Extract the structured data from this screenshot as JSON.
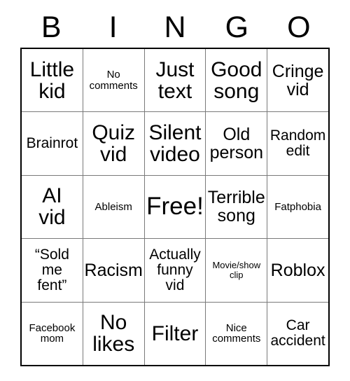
{
  "card": {
    "headers": [
      "B",
      "I",
      "N",
      "G",
      "O"
    ],
    "free_space_label": "Free!",
    "rows": [
      [
        {
          "text": "Little\nkid",
          "size": "lg"
        },
        {
          "text": "No\ncomments",
          "size": "xs"
        },
        {
          "text": "Just\ntext",
          "size": "lg"
        },
        {
          "text": "Good\nsong",
          "size": "lg"
        },
        {
          "text": "Cringe\nvid",
          "size": "md"
        }
      ],
      [
        {
          "text": "Brainrot",
          "size": "sm"
        },
        {
          "text": "Quiz\nvid",
          "size": "lg"
        },
        {
          "text": "Silent\nvideo",
          "size": "lg"
        },
        {
          "text": "Old\nperson",
          "size": "md"
        },
        {
          "text": "Random\nedit",
          "size": "sm"
        }
      ],
      [
        {
          "text": "AI\nvid",
          "size": "lg"
        },
        {
          "text": "Ableism",
          "size": "xs"
        },
        {
          "text": "Free!",
          "size": "xl"
        },
        {
          "text": "Terrible\nsong",
          "size": "md"
        },
        {
          "text": "Fatphobia",
          "size": "xs"
        }
      ],
      [
        {
          "text": "“Sold\nme\nfent”",
          "size": "sm"
        },
        {
          "text": "Racism",
          "size": "md"
        },
        {
          "text": "Actually\nfunny\nvid",
          "size": "sm"
        },
        {
          "text": "Movie/show\nclip",
          "size": "xxs"
        },
        {
          "text": "Roblox",
          "size": "md"
        }
      ],
      [
        {
          "text": "Facebook\nmom",
          "size": "xs"
        },
        {
          "text": "No\nlikes",
          "size": "lg"
        },
        {
          "text": "Filter",
          "size": "lg"
        },
        {
          "text": "Nice\ncomments",
          "size": "xs"
        },
        {
          "text": "Car\naccident",
          "size": "sm"
        }
      ]
    ]
  },
  "colors": {
    "text": "#000000",
    "background": "#ffffff",
    "grid_line": "#7a7a7a",
    "outer_border": "#000000"
  }
}
